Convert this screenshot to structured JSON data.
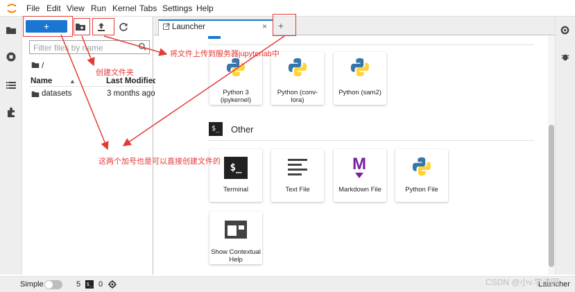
{
  "menu": [
    "File",
    "Edit",
    "View",
    "Run",
    "Kernel",
    "Tabs",
    "Settings",
    "Help"
  ],
  "filebrowser": {
    "new_label": "+",
    "search_placeholder": "Filter files by name",
    "breadcrumb": "/",
    "col_name": "Name",
    "col_modified": "Last Modified",
    "rows": [
      {
        "name": "datasets",
        "modified": "3 months ago"
      }
    ]
  },
  "tabs": {
    "launcher_label": "Launcher",
    "close_glyph": "×",
    "add_glyph": "+"
  },
  "launcher": {
    "notebook_cards": [
      {
        "label": "Python 3 (ipykernel)"
      },
      {
        "label": "Python (conv-lora)"
      },
      {
        "label": "Python (sam2)"
      }
    ],
    "other_title": "Other",
    "other_cards": [
      {
        "label": "Terminal",
        "icon": "terminal-icon"
      },
      {
        "label": "Text File",
        "icon": "text-file-icon"
      },
      {
        "label": "Markdown File",
        "icon": "markdown-icon"
      },
      {
        "label": "Python File",
        "icon": "python-icon"
      },
      {
        "label": "Show Contextual Help",
        "icon": "contextual-help-icon"
      }
    ]
  },
  "statusbar": {
    "mode_label": "Simple",
    "kernels_count": "5",
    "terminals_count": "0",
    "right_label": "Launcher"
  },
  "annotations": {
    "upload_note": "将文件上传到服务器jupyterlab中",
    "new_folder_note": "创建文件夹",
    "plus_note": "这两个加号也是可以直接创建文件的"
  },
  "watermark": "CSDN @小v.学渣同",
  "colors": {
    "accent": "#1976d2",
    "annotation": "#e53935",
    "markdown": "#7b1fa2"
  }
}
